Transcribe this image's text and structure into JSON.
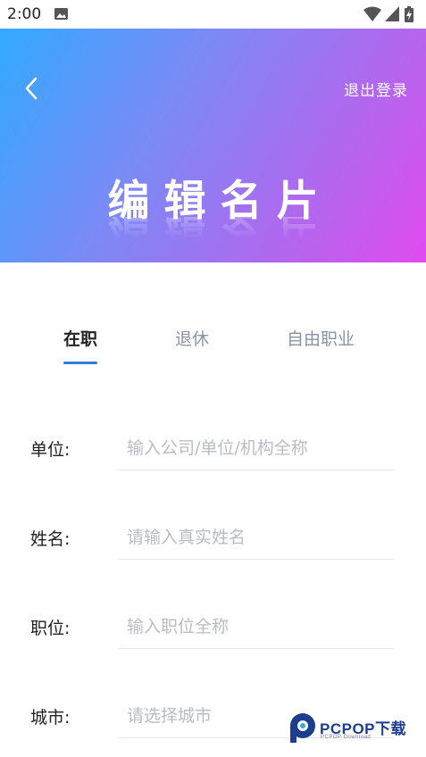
{
  "status_bar": {
    "time": "2:00",
    "icons": [
      "photo-icon",
      "wifi-icon",
      "signal-icon",
      "battery-charging-icon"
    ]
  },
  "header": {
    "back_icon": "chevron-left-icon",
    "logout_label": "退出登录",
    "title": "编辑名片",
    "gradient_colors": [
      "#33aaff",
      "#7e88f5",
      "#b565ee",
      "#e14af0"
    ]
  },
  "tabs": [
    {
      "label": "在职",
      "active": true
    },
    {
      "label": "退休",
      "active": false
    },
    {
      "label": "自由职业",
      "active": false
    }
  ],
  "accent_color": "#2f7de1",
  "form": {
    "company": {
      "label": "单位:",
      "value": "",
      "placeholder": "输入公司/单位/机构全称"
    },
    "name": {
      "label": "姓名:",
      "value": "",
      "placeholder": "请输入真实姓名"
    },
    "position": {
      "label": "职位:",
      "value": "",
      "placeholder": "输入职位全称"
    },
    "city": {
      "label": "城市:",
      "value": "",
      "placeholder": "请选择城市"
    }
  },
  "watermark": {
    "text": "PCPOP下载",
    "sub": "PCPOP Download"
  }
}
